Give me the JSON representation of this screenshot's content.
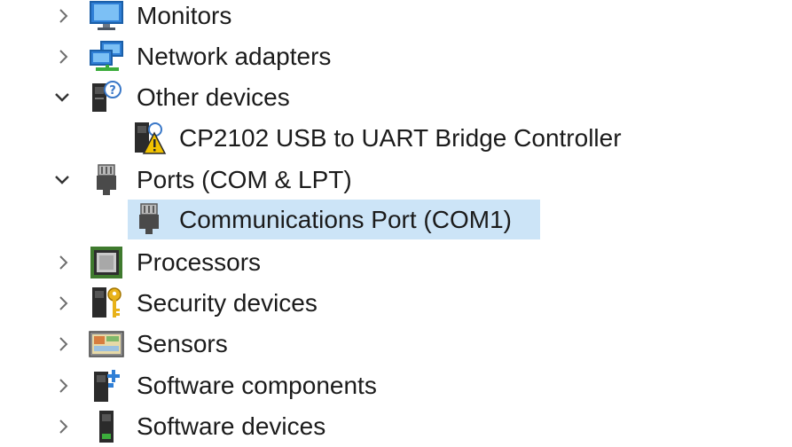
{
  "tree": {
    "items": [
      {
        "label": "Monitors",
        "icon": "monitor-icon",
        "state": "collapsed"
      },
      {
        "label": "Network adapters",
        "icon": "network-adapter-icon",
        "state": "collapsed"
      },
      {
        "label": "Other devices",
        "icon": "unknown-device-icon",
        "state": "expanded"
      },
      {
        "label": "CP2102 USB to UART Bridge Controller",
        "icon": "warning-device-icon",
        "state": "child"
      },
      {
        "label": "Ports (COM & LPT)",
        "icon": "port-icon",
        "state": "expanded"
      },
      {
        "label": "Communications Port (COM1)",
        "icon": "port-icon",
        "state": "child-selected"
      },
      {
        "label": "Processors",
        "icon": "processor-icon",
        "state": "collapsed"
      },
      {
        "label": "Security devices",
        "icon": "security-key-icon",
        "state": "collapsed"
      },
      {
        "label": "Sensors",
        "icon": "sensor-icon",
        "state": "collapsed"
      },
      {
        "label": "Software components",
        "icon": "software-component-icon",
        "state": "collapsed"
      },
      {
        "label": "Software devices",
        "icon": "software-device-icon",
        "state": "collapsed"
      }
    ]
  },
  "colors": {
    "selection": "#cce4f7",
    "text": "#1b1b1b",
    "chevron": "#6e6e6e"
  }
}
